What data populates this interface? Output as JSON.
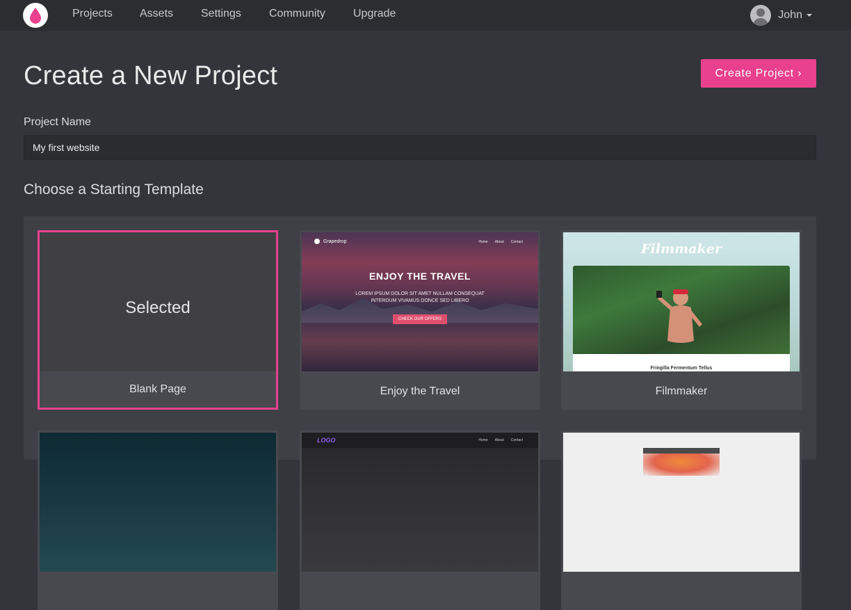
{
  "nav": {
    "items": [
      "Projects",
      "Assets",
      "Settings",
      "Community",
      "Upgrade"
    ],
    "user_name": "John"
  },
  "header": {
    "title": "Create a New Project",
    "create_button": "Create Project ›"
  },
  "form": {
    "project_name_label": "Project Name",
    "project_name_value": "My first website"
  },
  "templates": {
    "section_title": "Choose a Starting Template",
    "cards": [
      {
        "caption": "Blank Page",
        "overlay": "Selected",
        "selected": true
      },
      {
        "caption": "Enjoy the Travel",
        "preview": {
          "brand": "Grapedrop",
          "links": [
            "Home",
            "About",
            "Contact"
          ],
          "heading": "ENJOY THE  TRAVEL",
          "subtext": "LOREM IPSUM DOLOR SIT AMET NULLAM CONSEQUAT INTERDUM VIVAMUS DONCE SED LIBERO",
          "button": "CHECK OUR OFFERS"
        }
      },
      {
        "caption": "Filmmaker",
        "preview": {
          "title": "Filmmaker",
          "subcaption": "Fringilla Fermentum Tellus"
        }
      }
    ],
    "second_row": {
      "card2": {
        "logo": "LOGO",
        "links": [
          "Home",
          "About",
          "Contact"
        ]
      }
    }
  },
  "colors": {
    "accent": "#e9418e",
    "background": "#34353b",
    "nav_background": "#2c2d31"
  }
}
